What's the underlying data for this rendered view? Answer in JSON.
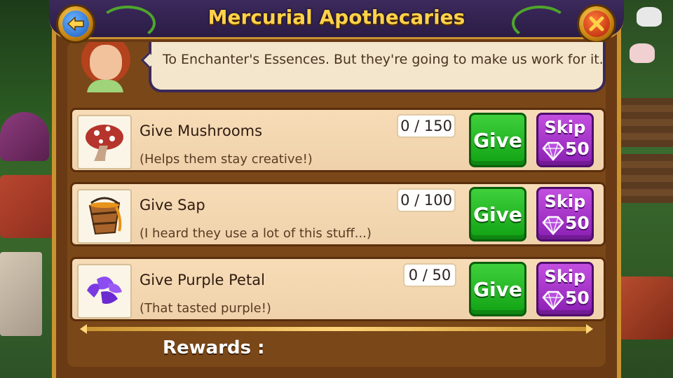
{
  "window": {
    "title": "Mercurial Apothecaries"
  },
  "dialogue": {
    "text": "To Enchanter's Essences. But they're going to make us work for it."
  },
  "tasks": [
    {
      "name": "Give Mushrooms",
      "description": "(Helps them stay creative!)",
      "progress": "0 / 150",
      "give_label": "Give",
      "skip_label": "Skip",
      "skip_cost": "50",
      "icon": "mushroom-icon"
    },
    {
      "name": "Give Sap",
      "description": "(I heard they use a lot of this stuff...)",
      "progress": "0 / 100",
      "give_label": "Give",
      "skip_label": "Skip",
      "skip_cost": "50",
      "icon": "sap-bucket-icon"
    },
    {
      "name": "Give Purple Petal",
      "description": "(That tasted purple!)",
      "progress": "0 / 50",
      "give_label": "Give",
      "skip_label": "Skip",
      "skip_cost": "50",
      "icon": "purple-petal-icon"
    }
  ],
  "rewards": {
    "label": "Rewards :"
  },
  "colors": {
    "give": "#1fb81e",
    "skip": "#a530c9",
    "title": "#ffd24a",
    "header": "#2b1c45",
    "panel": "#6a3a14"
  }
}
